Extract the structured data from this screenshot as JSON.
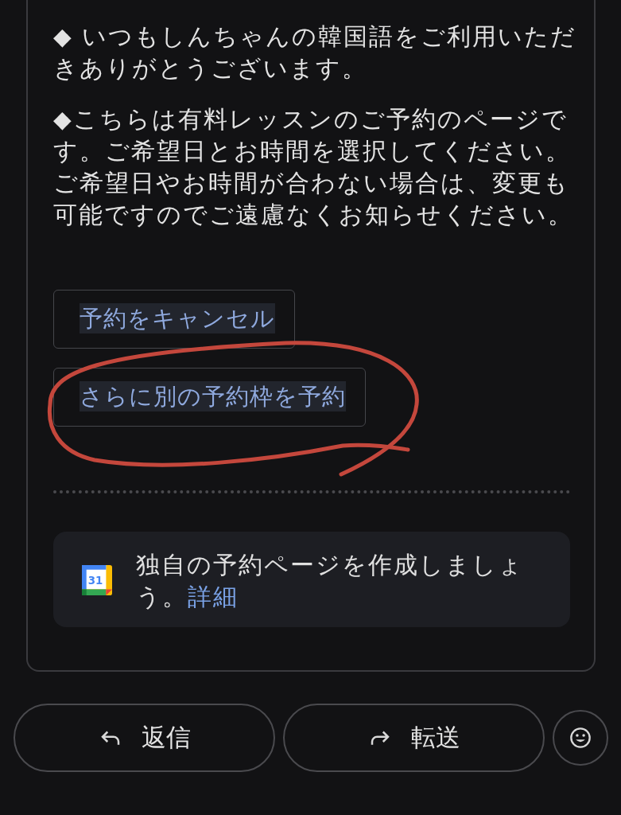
{
  "message": {
    "paragraphs": [
      "◆ いつもしんちゃんの韓国語をご利用いただきありがとうございます。",
      "◆こちらは有料レッスンのご予約のページです。ご希望日とお時間を選択してください。ご希望日やお時間が合わない場合は、変更も可能ですのでご遠慮なくお知らせください。"
    ],
    "actions": [
      {
        "label": "予約をキャンセル"
      },
      {
        "label": "さらに別の予約枠を予約"
      }
    ],
    "promo": {
      "icon_label": "31",
      "text": "独自の予約ページを作成しましょう。",
      "link": "詳細"
    }
  },
  "reply_bar": {
    "buttons": [
      {
        "kind": "reply",
        "label": "返信"
      },
      {
        "kind": "forward",
        "label": "転送"
      }
    ],
    "emoji_button": true
  }
}
